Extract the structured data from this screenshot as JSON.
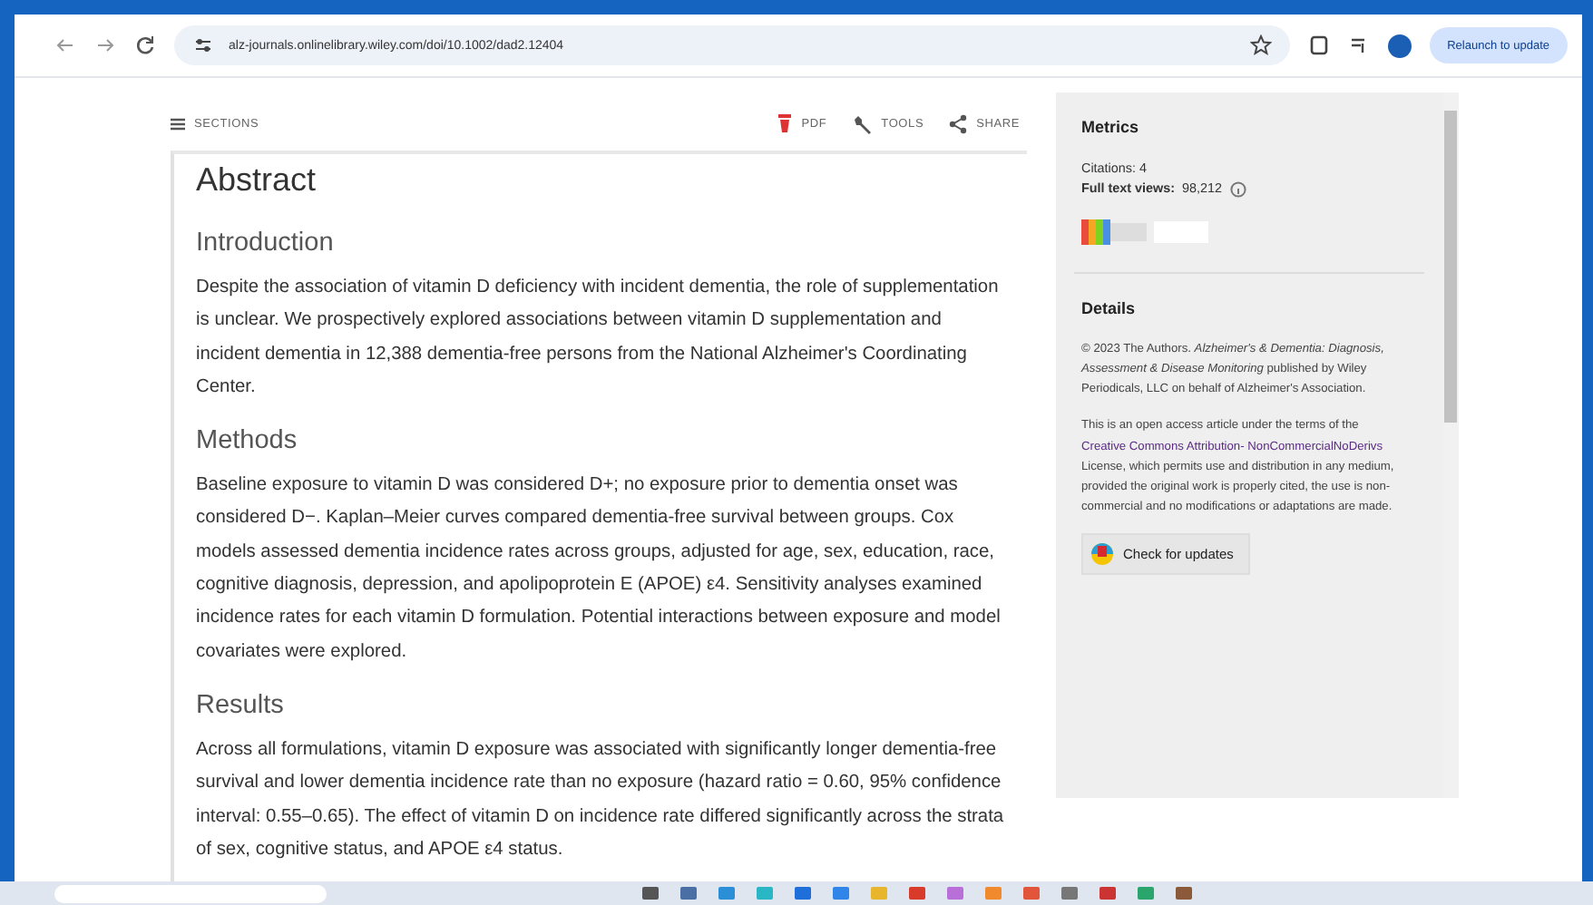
{
  "browser": {
    "url": "alz-journals.onlinelibrary.wiley.com/doi/10.1002/dad2.12404",
    "relaunch": "Relaunch to update"
  },
  "article_toolbar": {
    "sections": "SECTIONS",
    "actions": [
      {
        "kind": "pdf",
        "label": "PDF"
      },
      {
        "kind": "tools",
        "label": "TOOLS"
      },
      {
        "kind": "share",
        "label": "SHARE"
      }
    ]
  },
  "article": {
    "title": "Abstract",
    "sections": [
      {
        "heading": "Introduction",
        "text": "Despite the association of vitamin D deficiency with incident dementia, the role of supplementation is unclear. We prospectively explored associations between vitamin D supplementation and incident dementia in 12,388 dementia-free persons from the National Alzheimer's Coordinating Center."
      },
      {
        "heading": "Methods",
        "text": "Baseline exposure to vitamin D was considered D+; no exposure prior to dementia onset was considered D−. Kaplan–Meier curves compared dementia-free survival between groups. Cox models assessed dementia incidence rates across groups, adjusted for age, sex, education, race, cognitive diagnosis, depression, and apolipoprotein E (APOE) ε4. Sensitivity analyses examined incidence rates for each vitamin D formulation. Potential interactions between exposure and model covariates were explored."
      },
      {
        "heading": "Results",
        "text": "Across all formulations, vitamin D exposure was associated with significantly longer dementia-free survival and lower dementia incidence rate than no exposure (hazard ratio = 0.60, 95% confidence interval: 0.55–0.65). The effect of vitamin D on incidence rate differed significantly across the strata of sex, cognitive status, and APOE ε4 status."
      }
    ]
  },
  "sidebar": {
    "metrics": {
      "title": "Metrics",
      "citations": "Citations: 4",
      "views_label": "Full text views:",
      "views": "98,212"
    },
    "details": {
      "title": "Details",
      "copyright": "© 2023 The Authors. *Alzheimer's & Dementia: Diagnosis, Assessment & Disease Monitoring* published by Wiley Periodicals, LLC on behalf of Alzheimer's Association.",
      "license_before": "This is an open access article under the terms of the",
      "license_links": [
        "Creative Commons Attribution-",
        "NonCommercialNoDerivs"
      ],
      "license_after": "License, which permits use and distribution in any medium, provided the original work is properly cited, the use is non-commercial and no modifications or adaptations are made.",
      "update_button": "Check for updates"
    }
  }
}
